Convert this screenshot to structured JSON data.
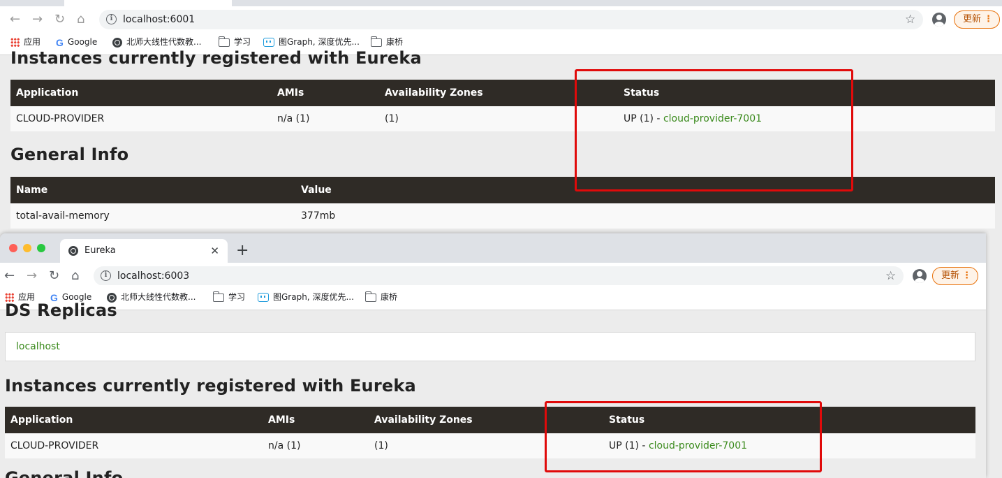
{
  "back_window": {
    "url": "localhost:6001",
    "update_label": "更新",
    "bookmarks": [
      "应用",
      "Google",
      "北师大线性代数教...",
      "学习",
      "图Graph, 深度优先...",
      "康桥"
    ],
    "instances_heading": "Instances currently registered with Eureka",
    "instances_table": {
      "headers": [
        "Application",
        "AMIs",
        "Availability Zones",
        "Status"
      ],
      "row": {
        "application": "CLOUD-PROVIDER",
        "amis": "n/a (1)",
        "zones": "(1)",
        "status_prefix": "UP (1) - ",
        "status_link": "cloud-provider-7001"
      }
    },
    "general_heading": "General Info",
    "general_table": {
      "headers": [
        "Name",
        "Value"
      ],
      "row": {
        "name": "total-avail-memory",
        "value": "377mb"
      }
    }
  },
  "front_window": {
    "tab_title": "Eureka",
    "url": "localhost:6003",
    "update_label": "更新",
    "bookmarks": [
      "应用",
      "Google",
      "北师大线性代数教...",
      "学习",
      "图Graph, 深度优先...",
      "康桥"
    ],
    "replicas_heading": "DS Replicas",
    "replica": "localhost",
    "instances_heading": "Instances currently registered with Eureka",
    "instances_table": {
      "headers": [
        "Application",
        "AMIs",
        "Availability Zones",
        "Status"
      ],
      "row": {
        "application": "CLOUD-PROVIDER",
        "amis": "n/a (1)",
        "zones": "(1)",
        "status_prefix": "UP (1) - ",
        "status_link": "cloud-provider-7001"
      }
    },
    "general_heading": "General Info"
  },
  "colors": {
    "table_header": "#2f2b26",
    "link_green": "#3a8a1c",
    "highlight_red": "#e00a0a"
  }
}
